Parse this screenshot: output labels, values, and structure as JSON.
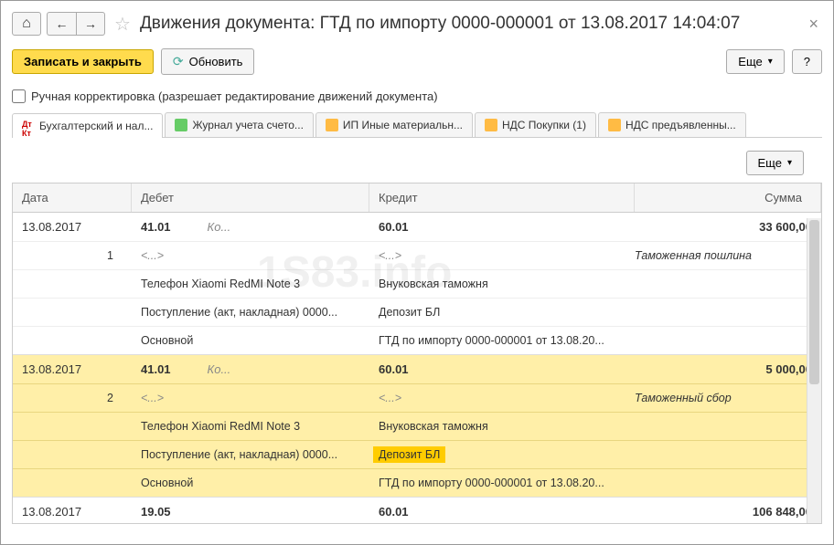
{
  "title": "Движения документа: ГТД по импорту 0000-000001 от 13.08.2017 14:04:07",
  "toolbar": {
    "save_close": "Записать и закрыть",
    "refresh": "Обновить",
    "more": "Еще",
    "help": "?"
  },
  "checkbox_label": "Ручная корректировка (разрешает редактирование движений документа)",
  "tabs": [
    {
      "label": "Бухгалтерский и нал...",
      "icon": "dt"
    },
    {
      "label": "Журнал учета счето...",
      "icon": "green"
    },
    {
      "label": "ИП Иные материальн...",
      "icon": "orange"
    },
    {
      "label": "НДС Покупки (1)",
      "icon": "orange"
    },
    {
      "label": "НДС предъявленны...",
      "icon": "orange"
    }
  ],
  "content_more": "Еще",
  "headers": {
    "date": "Дата",
    "debit": "Дебет",
    "credit": "Кредит",
    "sum": "Сумма"
  },
  "entries": [
    {
      "date": "13.08.2017",
      "num": "1",
      "debit_acc": "41.01",
      "debit_sub": "Ко...",
      "credit_acc": "60.01",
      "sum": "33 600,00",
      "sum_desc": "Таможенная пошлина",
      "ellipsis": "<...>",
      "debit_lines": [
        "Телефон Xiaomi RedMI Note 3",
        "Поступление (акт, накладная) 0000...",
        "Основной"
      ],
      "credit_lines": [
        "Внуковская таможня",
        "Депозит БЛ",
        "ГТД по импорту 0000-000001 от 13.08.20..."
      ]
    },
    {
      "date": "13.08.2017",
      "num": "2",
      "debit_acc": "41.01",
      "debit_sub": "Ко...",
      "credit_acc": "60.01",
      "sum": "5 000,00",
      "sum_desc": "Таможенный сбор",
      "ellipsis": "<...>",
      "debit_lines": [
        "Телефон Xiaomi RedMI Note 3",
        "Поступление (акт, накладная) 0000...",
        "Основной"
      ],
      "credit_lines": [
        "Внуковская таможня",
        "Депозит БЛ",
        "ГТД по импорту 0000-000001 от 13.08.20..."
      ]
    },
    {
      "date": "13.08.2017",
      "num": "",
      "debit_acc": "19.05",
      "debit_sub": "",
      "credit_acc": "60.01",
      "sum": "106 848,00",
      "sum_desc": "",
      "ellipsis": "",
      "debit_lines": [],
      "credit_lines": []
    }
  ],
  "watermark": "1S83.info"
}
